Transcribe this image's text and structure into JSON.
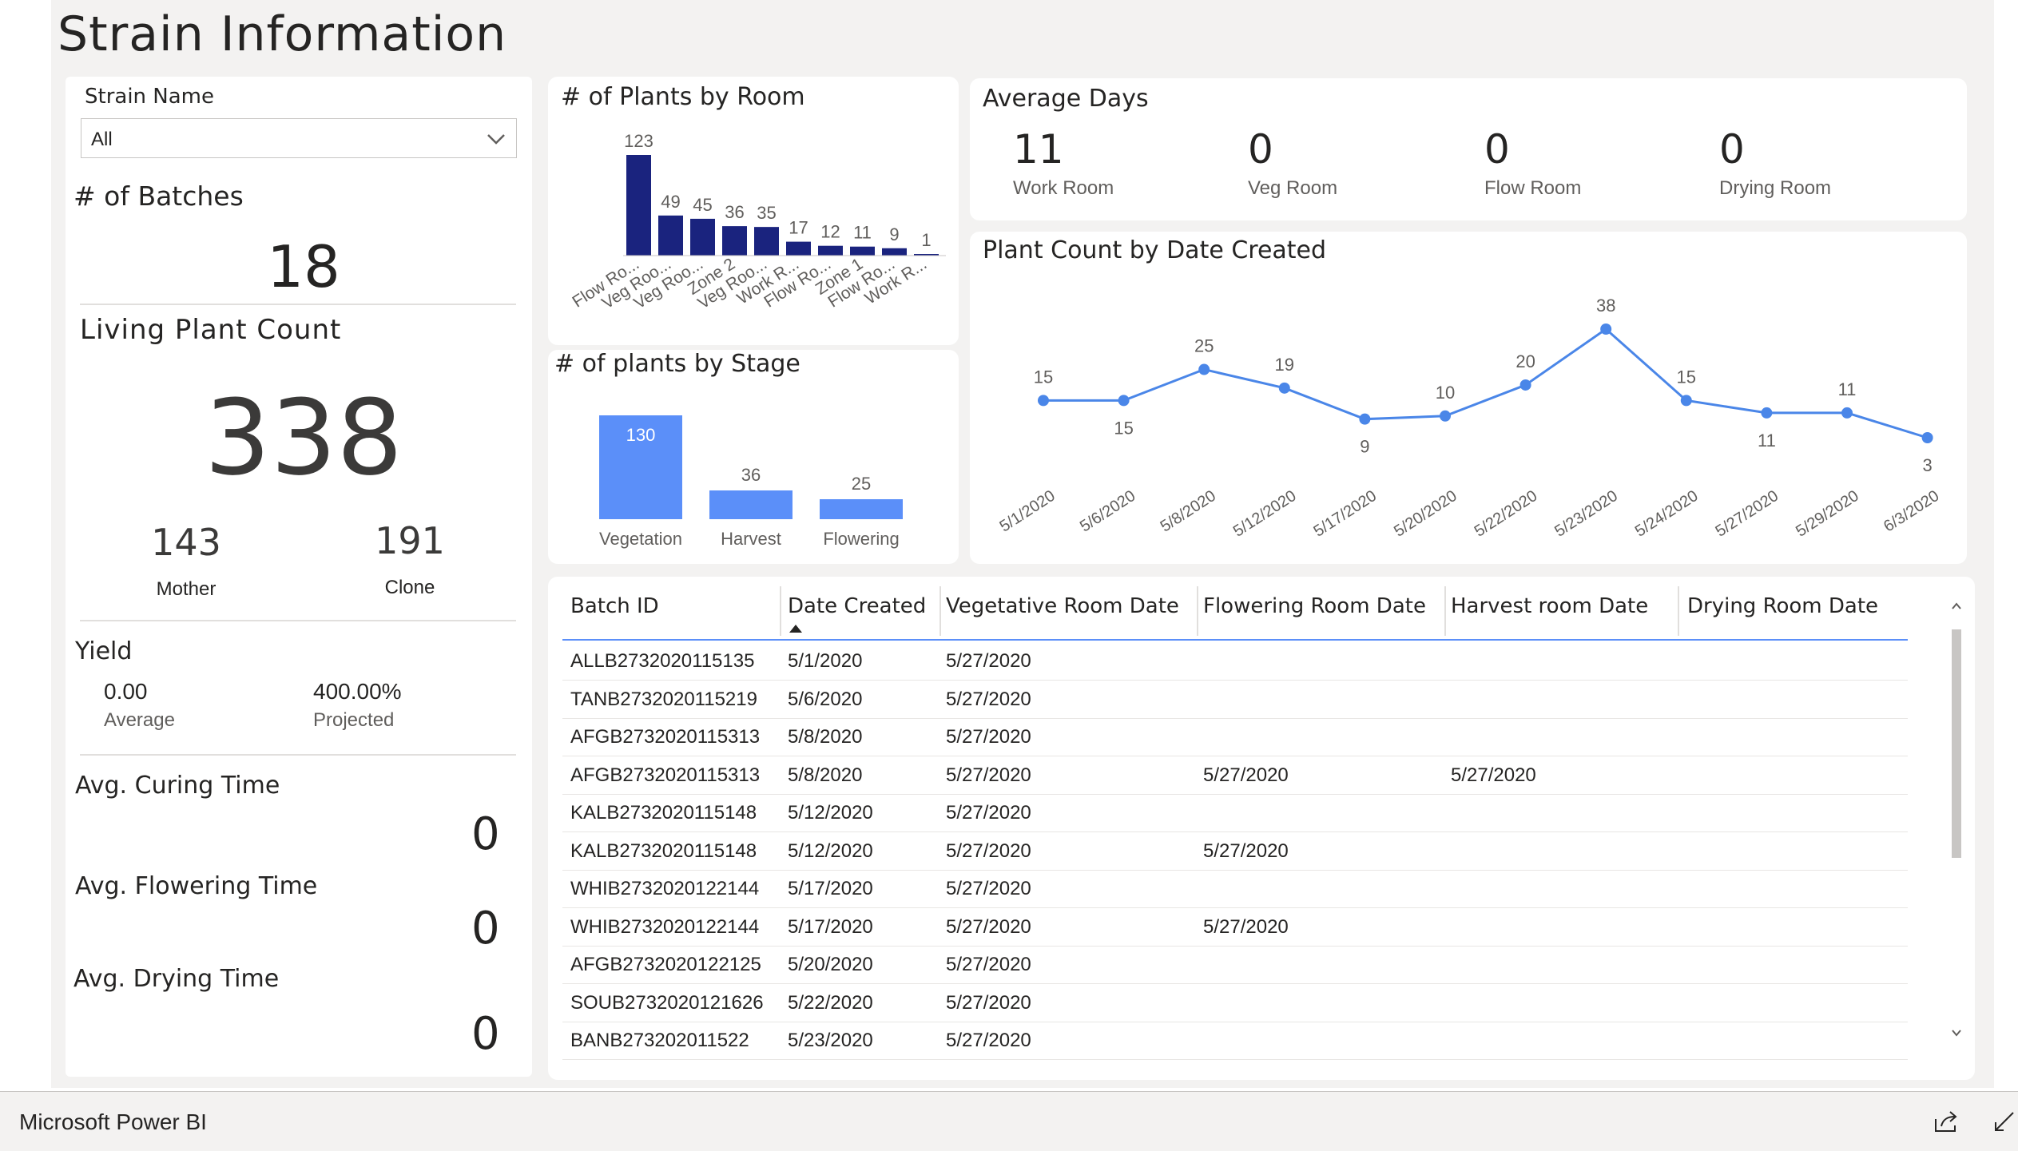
{
  "page_title": "Strain Information",
  "slicer": {
    "label": "Strain Name",
    "value": "All"
  },
  "batches": {
    "label": "# of Batches",
    "value": "18"
  },
  "living": {
    "label": "Living Plant Count",
    "value": "338",
    "mother_value": "143",
    "mother_label": "Mother",
    "clone_value": "191",
    "clone_label": "Clone"
  },
  "yield": {
    "label": "Yield",
    "average_value": "0.00",
    "average_label": "Average",
    "projected_value": "400.00%",
    "projected_label": "Projected"
  },
  "curing": {
    "label": "Avg. Curing Time",
    "value": "0"
  },
  "flowering": {
    "label": "Avg. Flowering Time",
    "value": "0"
  },
  "drying": {
    "label": "Avg. Drying Time",
    "value": "0"
  },
  "average_days": {
    "label": "Average Days",
    "items": [
      {
        "value": "11",
        "label": "Work Room"
      },
      {
        "value": "0",
        "label": "Veg Room"
      },
      {
        "value": "0",
        "label": "Flow Room"
      },
      {
        "value": "0",
        "label": "Drying Room"
      }
    ]
  },
  "colors": {
    "navy": "#1a237e",
    "blue": "#5b8ff9",
    "line": "#4a86e8"
  },
  "chart_data": [
    {
      "type": "bar",
      "title": "# of Plants by Room",
      "categories": [
        "Flow Ro...",
        "Veg Roo...",
        "Veg Roo...",
        "Zone 2",
        "Veg Roo...",
        "Work R...",
        "Flow Ro...",
        "Zone 1",
        "Flow Ro...",
        "Work R..."
      ],
      "values": [
        123,
        49,
        45,
        36,
        35,
        17,
        12,
        11,
        9,
        1
      ],
      "color": "#1a237e"
    },
    {
      "type": "bar",
      "title": "# of plants by Stage",
      "categories": [
        "Vegetation",
        "Harvest",
        "Flowering"
      ],
      "values": [
        130,
        36,
        25
      ],
      "color": "#5b8ff9"
    },
    {
      "type": "line",
      "title": "Plant Count by Date Created",
      "x": [
        "5/1/2020",
        "5/6/2020",
        "5/8/2020",
        "5/12/2020",
        "5/17/2020",
        "5/20/2020",
        "5/22/2020",
        "5/23/2020",
        "5/24/2020",
        "5/27/2020",
        "5/29/2020",
        "6/3/2020"
      ],
      "values": [
        15,
        15,
        25,
        19,
        9,
        10,
        20,
        38,
        15,
        11,
        11,
        3
      ],
      "color": "#4a86e8"
    }
  ],
  "table": {
    "columns": [
      "Batch ID",
      "Date Created",
      "Vegetative Room Date",
      "Flowering Room Date",
      "Harvest room Date",
      "Drying Room Date"
    ],
    "rows": [
      [
        "ALLB2732020115135",
        "5/1/2020",
        "5/27/2020",
        "",
        "",
        ""
      ],
      [
        "TANB2732020115219",
        "5/6/2020",
        "5/27/2020",
        "",
        "",
        ""
      ],
      [
        "AFGB2732020115313",
        "5/8/2020",
        "5/27/2020",
        "",
        "",
        ""
      ],
      [
        "AFGB2732020115313",
        "5/8/2020",
        "5/27/2020",
        "5/27/2020",
        "5/27/2020",
        ""
      ],
      [
        "KALB2732020115148",
        "5/12/2020",
        "5/27/2020",
        "",
        "",
        ""
      ],
      [
        "KALB2732020115148",
        "5/12/2020",
        "5/27/2020",
        "5/27/2020",
        "",
        ""
      ],
      [
        "WHIB2732020122144",
        "5/17/2020",
        "5/27/2020",
        "",
        "",
        ""
      ],
      [
        "WHIB2732020122144",
        "5/17/2020",
        "5/27/2020",
        "5/27/2020",
        "",
        ""
      ],
      [
        "AFGB2732020122125",
        "5/20/2020",
        "5/27/2020",
        "",
        "",
        ""
      ],
      [
        "SOUB2732020121626",
        "5/22/2020",
        "5/27/2020",
        "",
        "",
        ""
      ],
      [
        "BANB273202011522",
        "5/23/2020",
        "5/27/2020",
        "",
        "",
        ""
      ]
    ]
  },
  "footer": {
    "brand": "Microsoft Power BI"
  }
}
